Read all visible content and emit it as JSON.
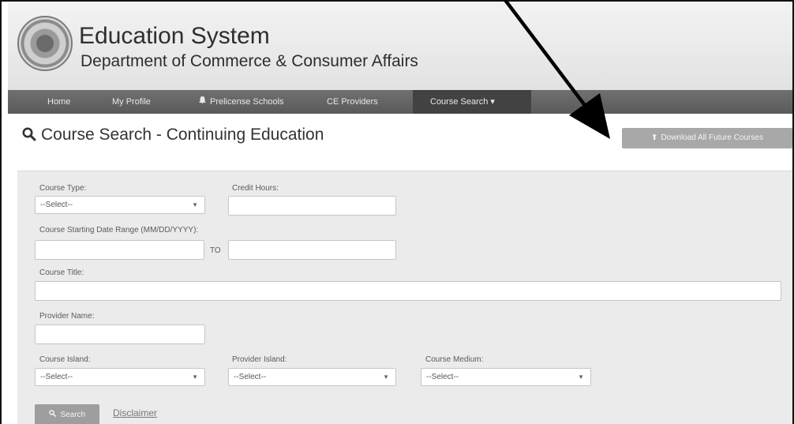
{
  "header": {
    "title": "Education System",
    "subtitle": "Department of Commerce & Consumer Affairs"
  },
  "nav": {
    "items": [
      {
        "label": "Home"
      },
      {
        "label": "My Profile"
      },
      {
        "label": "Prelicense Schools",
        "icon": "bell-icon"
      },
      {
        "label": "CE Providers"
      },
      {
        "label": "Course Search ▾",
        "active": true
      }
    ]
  },
  "page": {
    "title": "Course Search - Continuing Education",
    "download_button": "Download All Future Courses"
  },
  "form": {
    "course_type_label": "Course Type:",
    "course_type_value": "--Select--",
    "credit_hours_label": "Credit Hours:",
    "credit_hours_value": "",
    "date_range_label": "Course Starting Date Range (MM/DD/YYYY):",
    "date_from_value": "",
    "date_to_label": "TO",
    "date_to_value": "",
    "course_title_label": "Course Title:",
    "course_title_value": "",
    "provider_name_label": "Provider Name:",
    "provider_name_value": "",
    "course_island_label": "Course Island:",
    "course_island_value": "--Select--",
    "provider_island_label": "Provider Island:",
    "provider_island_value": "--Select--",
    "course_medium_label": "Course Medium:",
    "course_medium_value": "--Select--",
    "search_button": "Search",
    "disclaimer_link": "Disclaimer"
  },
  "colors": {
    "nav_bg": "#646464",
    "nav_active": "#424242",
    "button_bg": "#a8a8a8",
    "panel_bg": "#ebebeb"
  }
}
